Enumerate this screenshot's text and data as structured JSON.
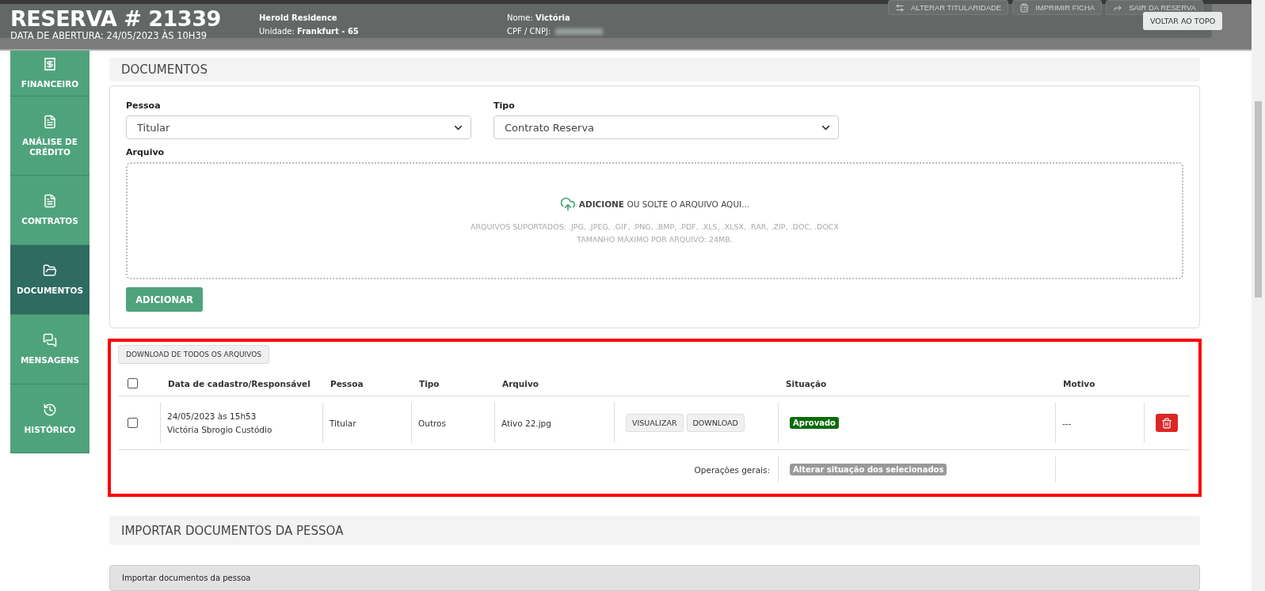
{
  "header": {
    "title": "RESERVA # 21339",
    "opened": "DATA DE ABERTURA: 24/05/2023 ÀS 10H39",
    "property": "Herold Residence",
    "unit_label": "Unidade:",
    "unit": "Frankfurt - 65",
    "name_label": "Nome:",
    "name": "Victória",
    "cpf_label": "CPF / CNPJ:",
    "cpf_redacted": true,
    "actions": [
      {
        "label": "ALTERAR TITULARIDADE"
      },
      {
        "label": "IMPRIMIR FICHA"
      },
      {
        "label": "SAIR DA RESERVA"
      }
    ],
    "back_to_top": "VOLTAR AO TOPO"
  },
  "sidebar": {
    "items": [
      {
        "label": "FINANCEIRO",
        "selected": false
      },
      {
        "label": "ANÁLISE DE CRÉDITO",
        "selected": false
      },
      {
        "label": "CONTRATOS",
        "selected": false
      },
      {
        "label": "DOCUMENTOS",
        "selected": true
      },
      {
        "label": "MENSAGENS",
        "selected": false
      },
      {
        "label": "HISTÓRICO",
        "selected": false
      }
    ]
  },
  "documents": {
    "title": "DOCUMENTOS",
    "person_field": {
      "label": "Pessoa",
      "value": "Titular"
    },
    "type_field": {
      "label": "Tipo",
      "value": "Contrato Reserva"
    },
    "file_field": {
      "label": "Arquivo",
      "action": "ADICIONE",
      "prompt": "OU SOLTE O ARQUIVO AQUI...",
      "formats": "ARQUIVOS SUPORTADOS: .JPG, .JPEG, .GIF, .PNG, .BMP, .PDF, .XLS, .XLSX, .RAR, .ZIP, .DOC, .DOCX",
      "max_size": "TAMANHO MÁXIMO POR ARQUIVO: 24MB."
    },
    "add_button": "ADICIONAR",
    "download_all": "DOWNLOAD DE TODOS OS ARQUIVOS",
    "table": {
      "all_checked": false,
      "columns": [
        "Data de cadastro/Responsável",
        "Pessoa",
        "Tipo",
        "Arquivo",
        "Situação",
        "Motivo"
      ],
      "rows": [
        {
          "checked": false,
          "date": "24/05/2023 às 15h53",
          "responsible": "Victória Sbrogio Custódio",
          "person": "Titular",
          "type": "Outros",
          "file": "Ativo 22.jpg",
          "view": "VISUALIZAR",
          "download": "DOWNLOAD",
          "status": "Aprovado",
          "color": "#0b6b0b",
          "reason": "---"
        }
      ],
      "footer_label": "Operações gerais:",
      "footer_action": "Alterar situação dos selecionados"
    }
  },
  "import": {
    "title": "IMPORTAR DOCUMENTOS DA PESSOA",
    "bar": "Importar documentos da pessoa"
  }
}
